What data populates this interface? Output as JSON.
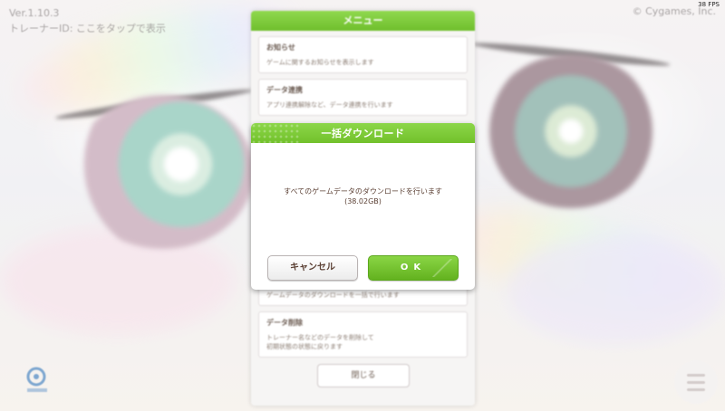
{
  "status": {
    "fps": "38 FPS"
  },
  "overlay": {
    "version": "Ver.1.10.3",
    "trainer_id_line": "トレーナーID: ここをタップで表示",
    "top_right": "© Cygames, Inc."
  },
  "menu": {
    "title": "メニュー",
    "items": [
      {
        "title": "お知らせ",
        "desc": "ゲームに関するお知らせを表示します"
      },
      {
        "title": "データ連携",
        "desc": "アプリ連携解除など、データ連携を行います"
      }
    ],
    "lower_items": [
      {
        "title": "",
        "desc": "ゲームデータのダウンロードを一括で行います"
      },
      {
        "title": "データ削除",
        "desc": "トレーナー名などのデータを削除して\n初期状態の状態に戻ります"
      }
    ],
    "close_label": "閉じる"
  },
  "dialog": {
    "title": "一括ダウンロード",
    "message": "すべてのゲームデータのダウンロードを行います",
    "size": "(38.02GB)",
    "cancel_label": "キャンセル",
    "ok_label": "OK"
  },
  "colors": {
    "accent_green": "#72c12b",
    "text_brown": "#5c4135"
  },
  "icons": {
    "corner_left": "app-logo-icon",
    "corner_right": "hamburger-menu-icon"
  }
}
